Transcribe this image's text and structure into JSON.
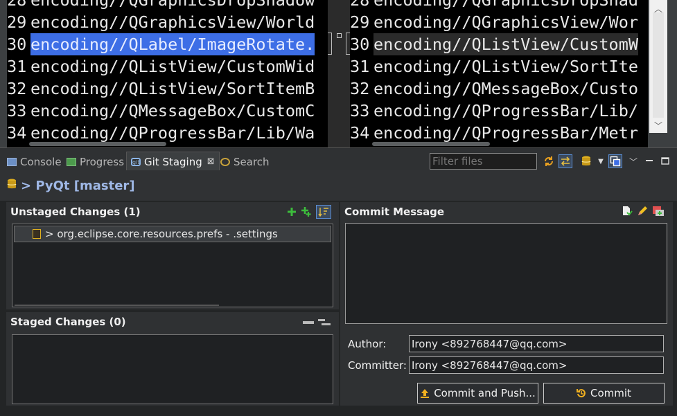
{
  "editor": {
    "left_lines": [
      {
        "num": "28",
        "text": "encoding//QGraphicsDropShadow"
      },
      {
        "num": "29",
        "text": "encoding//QGraphicsView/World"
      },
      {
        "num": "30",
        "text": "encoding//QLabel/ImageRotate.",
        "highlight": true
      },
      {
        "num": "31",
        "text": "encoding//QListView/CustomWid"
      },
      {
        "num": "32",
        "text": "encoding//QListView/SortItemB"
      },
      {
        "num": "33",
        "text": "encoding//QMessageBox/CustomC"
      },
      {
        "num": "34",
        "text": "encoding//QProgressBar/Lib/Wa"
      }
    ],
    "right_lines": [
      {
        "num": "28",
        "text": "encoding//QGraphicsDropShad"
      },
      {
        "num": "29",
        "text": "encoding//QGraphicsView/Wor"
      },
      {
        "num": "30",
        "text": "encoding//QListView/CustomW",
        "highlight": true
      },
      {
        "num": "31",
        "text": "encoding//QListView/SortIte"
      },
      {
        "num": "32",
        "text": "encoding//QMessageBox/Custo"
      },
      {
        "num": "33",
        "text": "encoding//QProgressBar/Lib/"
      },
      {
        "num": "34",
        "text": "encoding//QProgressBar/Metr"
      }
    ]
  },
  "tabs": [
    {
      "label": "Console",
      "icon": "console-icon"
    },
    {
      "label": "Progress",
      "icon": "progress-icon"
    },
    {
      "label": "Git Staging",
      "icon": "git-icon",
      "active": true
    },
    {
      "label": "Search",
      "icon": "search-icon"
    }
  ],
  "toolbar": {
    "filter_placeholder": "Filter files",
    "close_glyph": "⊠"
  },
  "repo": {
    "title": "> PyQt [master]"
  },
  "unstaged": {
    "title": "Unstaged Changes (1)",
    "files": [
      {
        "name": "> org.eclipse.core.resources.prefs - .settings"
      }
    ]
  },
  "staged": {
    "title": "Staged Changes (0)"
  },
  "commit": {
    "title": "Commit Message",
    "author_label": "Author:",
    "author_value": "Irony <892768447@qq.com>",
    "committer_label": "Committer:",
    "committer_value": "Irony <892768447@qq.com>",
    "commit_push_label": "Commit and Push...",
    "commit_label": "Commit"
  },
  "colors": {
    "accent": "#3d6ee6",
    "add": "#3cbc3c",
    "db": "#e0b020"
  }
}
